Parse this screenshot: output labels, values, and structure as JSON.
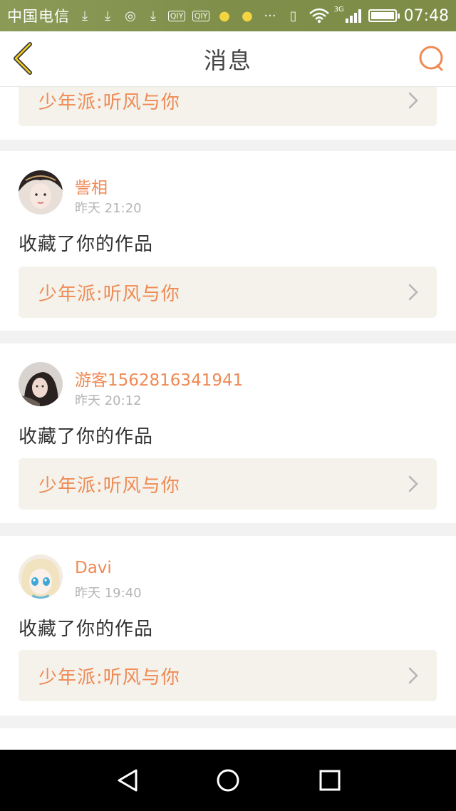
{
  "status_bar": {
    "carrier": "中国电信",
    "network": "3G",
    "time": "07:48",
    "icons": [
      "download-icon",
      "download-icon",
      "location-icon",
      "download-icon",
      "iqiyi-icon",
      "iqiyi-icon",
      "bulb-icon",
      "bulb-icon",
      "more-icon",
      "vibrate-icon",
      "wifi-icon",
      "signal-icon",
      "battery-icon"
    ]
  },
  "header": {
    "title": "消息"
  },
  "work_title": "少年派:听风与你",
  "messages": [
    {
      "name": "訾相",
      "time": "昨天 21:20",
      "action": "收藏了你的作品",
      "work": "少年派:听风与你"
    },
    {
      "name": "游客1562816341941",
      "time": "昨天 20:12",
      "action": "收藏了你的作品",
      "work": "少年派:听风与你"
    },
    {
      "name": "Davi",
      "time": "昨天 19:40",
      "action": "收藏了你的作品",
      "work": "少年派:听风与你"
    }
  ],
  "colors": {
    "accent": "#ef8a54",
    "status_bar": "#879552",
    "link_bg": "#f4f2eb"
  }
}
